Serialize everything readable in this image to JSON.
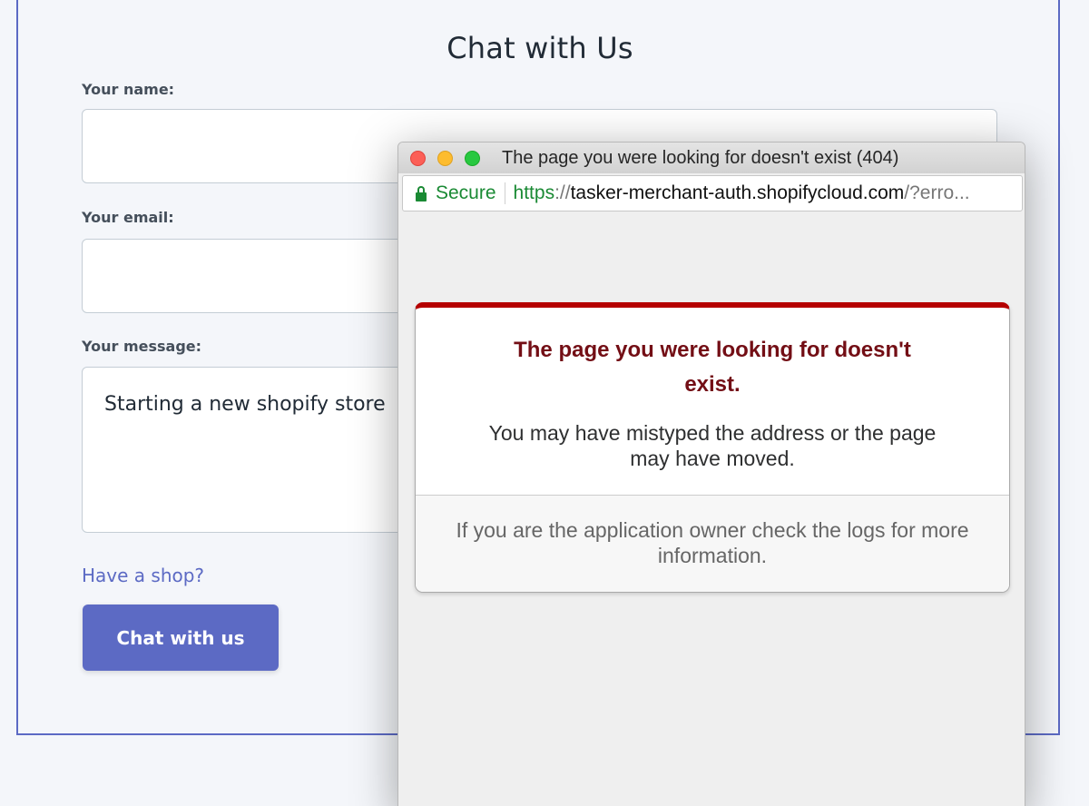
{
  "chat_form": {
    "title": "Chat with Us",
    "name_label": "Your name:",
    "name_value": "",
    "email_label": "Your email:",
    "email_value": "",
    "message_label": "Your message:",
    "message_value": "Starting a new shopify store",
    "have_shop_link": "Have a shop?",
    "submit_label": "Chat with us"
  },
  "popup": {
    "window_title": "The page you were looking for doesn't exist (404)",
    "address_bar": {
      "security_label": "Secure",
      "url_scheme": "https",
      "url_slashes": "://",
      "url_host": "tasker-merchant-auth.shopifycloud.com",
      "url_rest": "/?erro..."
    },
    "error_card": {
      "heading": "The page you were looking for doesn't exist.",
      "body": "You may have mistyped the address or the page may have moved.",
      "footer": "If you are the application owner check the logs for more information."
    }
  },
  "colors": {
    "brand_indigo": "#5c6ac4",
    "secure_green": "#1a8a34",
    "error_red": "#b50000",
    "error_heading": "#730e15"
  },
  "icons": {
    "lock": "lock-icon",
    "window_close": "close-window-button",
    "window_minimize": "minimize-window-button",
    "window_maximize": "maximize-window-button"
  }
}
